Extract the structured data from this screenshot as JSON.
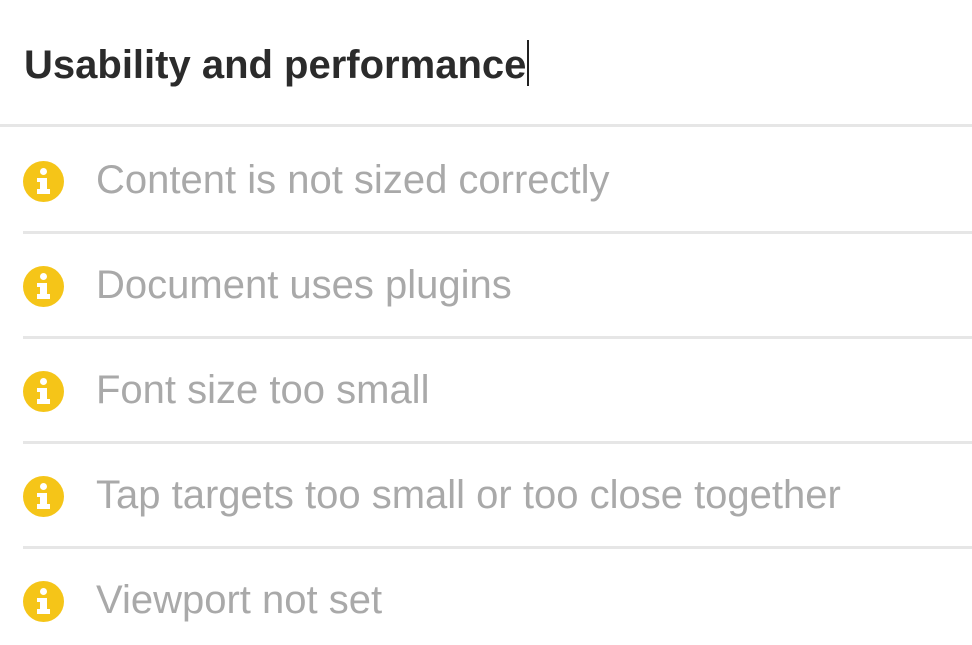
{
  "section": {
    "title": "Usability and performance"
  },
  "items": [
    {
      "label": "Content is not sized correctly",
      "icon": "info-icon",
      "icon_color": "#f5c518"
    },
    {
      "label": "Document uses plugins",
      "icon": "info-icon",
      "icon_color": "#f5c518"
    },
    {
      "label": "Font size too small",
      "icon": "info-icon",
      "icon_color": "#f5c518"
    },
    {
      "label": "Tap targets too small or too close together",
      "icon": "info-icon",
      "icon_color": "#f5c518"
    },
    {
      "label": "Viewport not set",
      "icon": "info-icon",
      "icon_color": "#f5c518"
    }
  ],
  "colors": {
    "title_text": "#2b2b2b",
    "item_text": "#a9a9a9",
    "divider": "#e6e6e6",
    "info_accent": "#f5c518"
  }
}
